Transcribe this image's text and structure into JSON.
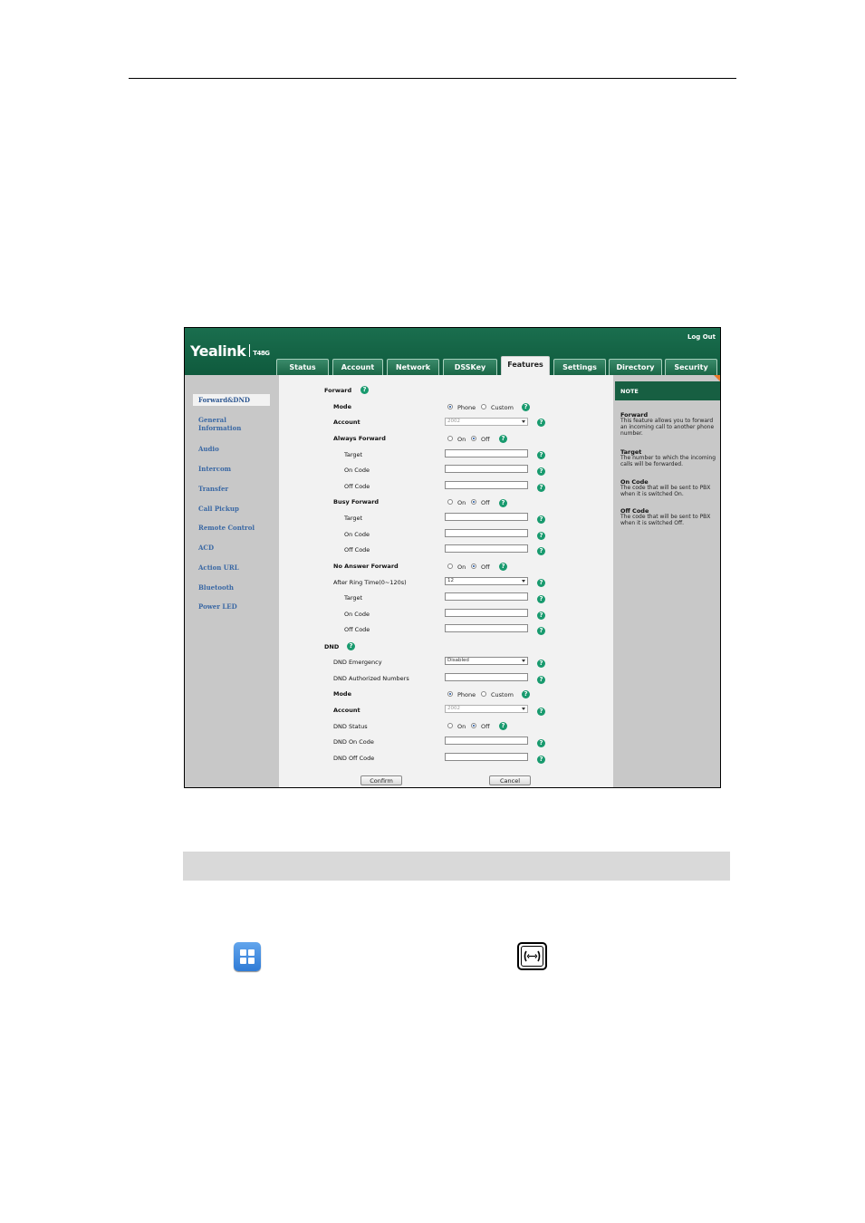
{
  "header": {
    "brand": "Yealink",
    "model": "T48G",
    "logout": "Log Out"
  },
  "tabs": [
    "Status",
    "Account",
    "Network",
    "DSSKey",
    "Features",
    "Settings",
    "Directory",
    "Security"
  ],
  "active_tab": "Features",
  "sidebar": {
    "active": "Forward&DND",
    "items": [
      "General",
      "Information",
      "Audio",
      "Intercom",
      "Transfer",
      "Call Pickup",
      "Remote Control",
      "ACD",
      "Action URL",
      "Bluetooth",
      "Power LED"
    ]
  },
  "forward": {
    "section": "Forward",
    "mode_label": "Mode",
    "mode_phone": "Phone",
    "mode_custom": "Custom",
    "account_label": "Account",
    "account_value": "2002",
    "always_forward": "Always Forward",
    "busy_forward": "Busy Forward",
    "no_answer_forward": "No Answer Forward",
    "on": "On",
    "off": "Off",
    "target": "Target",
    "on_code": "On Code",
    "off_code": "Off Code",
    "after_ring_label": "After Ring Time(0~120s)",
    "after_ring_value": "12"
  },
  "dnd": {
    "section": "DND",
    "emergency_label": "DND Emergency",
    "emergency_value": "Disabled",
    "authorized_label": "DND Authorized Numbers",
    "mode_label": "Mode",
    "mode_phone": "Phone",
    "mode_custom": "Custom",
    "account_label": "Account",
    "account_value": "2002",
    "status_label": "DND Status",
    "on": "On",
    "off": "Off",
    "on_code_label": "DND On Code",
    "off_code_label": "DND Off Code"
  },
  "buttons": {
    "confirm": "Confirm",
    "cancel": "Cancel"
  },
  "note": {
    "title": "NOTE",
    "items": [
      {
        "heading": "Forward",
        "text": "This feature allows you to forward an incoming call to another phone number."
      },
      {
        "heading": "Target",
        "text": "The number to which the incoming calls will be forwarded."
      },
      {
        "heading": "On Code",
        "text": "The code that will be sent to PBX when it is switched On."
      },
      {
        "heading": "Off Code",
        "text": "The code that will be sent to PBX when it is switched Off."
      }
    ]
  },
  "icons": {
    "menu": "menu-grid-icon",
    "transfer": "transfer-key-icon",
    "help": "help-icon"
  },
  "colors": {
    "header_green": "#0f5a3d",
    "link_blue": "#3a68a4",
    "help_green": "#189a6e",
    "note_accent": "#e9782a"
  }
}
